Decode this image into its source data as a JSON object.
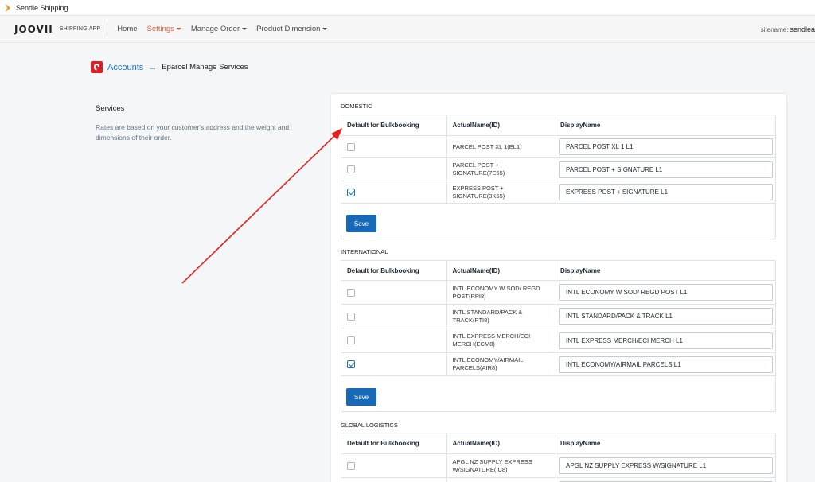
{
  "window": {
    "title": "Sendle Shipping",
    "icon": "chevron-right-icon"
  },
  "navbar": {
    "logo": "JOOVII",
    "logo_sub": "SHIPPING APP",
    "items": [
      {
        "label": "Home",
        "dropdown": false,
        "active": false
      },
      {
        "label": "Settings",
        "dropdown": true,
        "active": true
      },
      {
        "label": "Manage Order",
        "dropdown": true,
        "active": false
      },
      {
        "label": "Product Dimension",
        "dropdown": true,
        "active": false
      }
    ],
    "sitename_label": "sitename:",
    "sitename_value": "sendlea"
  },
  "breadcrumb": {
    "icon": "auspost-logo-icon",
    "link": "Accounts",
    "arrow": "→",
    "current": "Eparcel Manage Services"
  },
  "services": {
    "title": "Services",
    "description": "Rates are based on your customer's address and the weight and dimensions of their order."
  },
  "columns": {
    "default": "Default for Bulkbooking",
    "actual": "ActualName(ID)",
    "display": "DisplayName"
  },
  "save_label": "Save",
  "sections": {
    "domestic": {
      "title": "DOMESTIC",
      "rows": [
        {
          "actual": "PARCEL POST XL 1(EL1)",
          "display": "PARCEL POST XL 1 L1",
          "checked": false
        },
        {
          "actual": "PARCEL POST + SIGNATURE(7E55)",
          "display": "PARCEL POST + SIGNATURE L1",
          "checked": false
        },
        {
          "actual": "EXPRESS POST + SIGNATURE(3K55)",
          "display": "EXPRESS POST + SIGNATURE L1",
          "checked": true
        }
      ]
    },
    "international": {
      "title": "INTERNATIONAL",
      "rows": [
        {
          "actual": "INTL ECONOMY W SOD/ REGD POST(RPI8)",
          "display": "INTL ECONOMY W SOD/ REGD POST L1",
          "checked": false
        },
        {
          "actual": "INTL STANDARD/PACK & TRACK(PTI8)",
          "display": "INTL STANDARD/PACK & TRACK L1",
          "checked": false
        },
        {
          "actual": "INTL EXPRESS MERCH/ECI MERCH(ECM8)",
          "display": "INTL EXPRESS MERCH/ECI MERCH L1",
          "checked": false
        },
        {
          "actual": "INTL ECONOMY/AIRMAIL PARCELS(AIR8)",
          "display": "INTL ECONOMY/AIRMAIL PARCELS L1",
          "checked": true
        }
      ]
    },
    "global": {
      "title": "GLOBAL LOGISTICS",
      "rows": [
        {
          "actual": "APGL NZ SUPPLY EXPRESS W/SIGNATURE(IC8)",
          "display": "APGL NZ SUPPLY EXPRESS W/SIGNATURE L1",
          "checked": false
        }
      ]
    }
  },
  "annotation": {
    "color": "#e8201c"
  }
}
